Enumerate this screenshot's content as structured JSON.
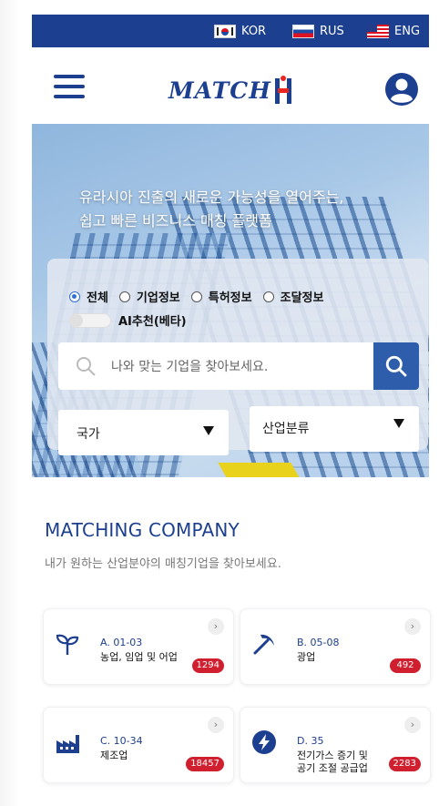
{
  "languages": [
    {
      "label": "KOR",
      "flag": "korea-flag-icon"
    },
    {
      "label": "RUS",
      "flag": "russia-flag-icon"
    },
    {
      "label": "ENG",
      "flag": "usa-flag-icon"
    }
  ],
  "header": {
    "logo": "MATCH",
    "menu_icon": "hamburger-menu-icon",
    "user_icon": "user-account-icon"
  },
  "hero": {
    "line1": "유라시아 진출의 새로운 가능성을 열어주는,",
    "line2": "쉽고 빠른 비즈니스 매칭 플랫폼"
  },
  "search": {
    "radios": [
      {
        "label": "전체",
        "selected": true
      },
      {
        "label": "기업정보",
        "selected": false
      },
      {
        "label": "특허정보",
        "selected": false
      },
      {
        "label": "조달정보",
        "selected": false
      }
    ],
    "ai_label": "AI추천(베타)",
    "ai_enabled": false,
    "placeholder": "나와 맞는 기업을 찾아보세요.",
    "country_label": "국가",
    "industry_label": "산업분류"
  },
  "section": {
    "title": "MATCHING COMPANY",
    "subtitle": "내가 원하는 산업분야의 매칭기업을 찾아보세요."
  },
  "categories": [
    {
      "code": "A. 01-03",
      "name": "농업, 임업 및 어업",
      "count": "1294",
      "icon": "sprout-icon"
    },
    {
      "code": "B. 05-08",
      "name": "광업",
      "count": "492",
      "icon": "pickaxe-icon"
    },
    {
      "code": "C. 10-34",
      "name": "제조업",
      "count": "18457",
      "icon": "factory-icon"
    },
    {
      "code": "D. 35",
      "name": "전기가스 증기 및 공기 조절 공급업",
      "name_line1": "전기가스 증기 및",
      "name_line2": "공기 조절 공급업",
      "count": "2283",
      "icon": "lightning-icon"
    }
  ],
  "colors": {
    "primary": "#1d3f8f",
    "accent_red": "#d01f2e",
    "search_button": "#2d5dab"
  }
}
